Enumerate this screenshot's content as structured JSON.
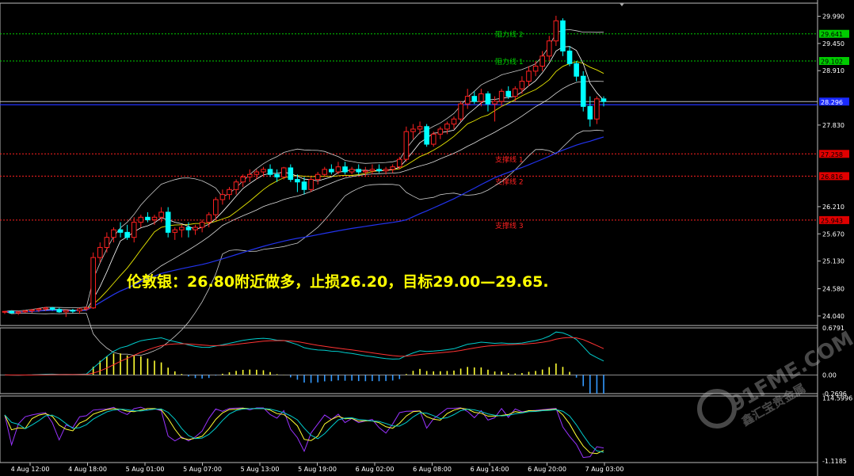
{
  "chart_data": {
    "type": "candlestick",
    "annotation": "伦敦银：26.80附近做多，止损26.20，目标29.00—29.65.",
    "watermark": {
      "main": "91FME.COM",
      "sub": "鑫汇宝贵金属"
    },
    "main_panel": {
      "price_ticks": [
        "29.990",
        "29.450",
        "28.910",
        "27.830",
        "26.210",
        "25.670",
        "25.130",
        "24.580",
        "24.040"
      ],
      "current_price": "28.296",
      "bg": "#000000",
      "bull_color": "#ff2020",
      "bear_color": "#00ffff",
      "levels": [
        {
          "label": "阻力线 2",
          "price": 29.641,
          "tag": "29.641",
          "color": "#00cc00",
          "tag_bg": "#00cc00"
        },
        {
          "label": "阻力线 1",
          "price": 29.102,
          "tag": "29.102",
          "color": "#00cc00",
          "tag_bg": "#00cc00"
        },
        {
          "label": "支撑线 1",
          "price": 27.258,
          "tag": "27.258",
          "color": "#ff2020",
          "tag_bg": "#e00000"
        },
        {
          "label": "支撑线 2",
          "price": 26.816,
          "tag": "26.816",
          "color": "#ff2020",
          "tag_bg": "#e00000"
        },
        {
          "label": "支撑线 3",
          "price": 25.943,
          "tag": "25.943",
          "color": "#ff2020",
          "tag_bg": "#e00000"
        }
      ],
      "x_labels": [
        "4 Aug 12:00",
        "4 Aug 18:00",
        "5 Aug 01:00",
        "5 Aug 07:00",
        "5 Aug 13:00",
        "5 Aug 19:00",
        "6 Aug 02:00",
        "6 Aug 08:00",
        "6 Aug 14:00",
        "6 Aug 20:00",
        "7 Aug 03:00"
      ],
      "candles": [
        [
          24.12,
          24.14,
          24.08,
          24.13
        ],
        [
          24.13,
          24.15,
          24.09,
          24.1
        ],
        [
          24.1,
          24.14,
          24.06,
          24.12
        ],
        [
          24.12,
          24.16,
          24.1,
          24.14
        ],
        [
          24.14,
          24.18,
          24.1,
          24.16
        ],
        [
          24.16,
          24.2,
          24.12,
          24.18
        ],
        [
          24.18,
          24.22,
          24.14,
          24.2
        ],
        [
          24.2,
          24.22,
          24.14,
          24.17
        ],
        [
          24.17,
          24.2,
          24.1,
          24.12
        ],
        [
          24.12,
          24.16,
          24.02,
          24.15
        ],
        [
          24.15,
          24.18,
          24.1,
          24.14
        ],
        [
          24.14,
          24.2,
          24.08,
          24.18
        ],
        [
          24.18,
          24.24,
          24.14,
          24.2
        ],
        [
          24.2,
          25.3,
          24.18,
          25.2
        ],
        [
          25.2,
          25.5,
          25.1,
          25.4
        ],
        [
          25.4,
          25.7,
          25.3,
          25.6
        ],
        [
          25.6,
          25.8,
          25.5,
          25.75
        ],
        [
          25.75,
          25.9,
          25.6,
          25.7
        ],
        [
          25.7,
          25.85,
          25.55,
          25.6
        ],
        [
          25.6,
          26.0,
          25.5,
          25.9
        ],
        [
          25.9,
          26.05,
          25.8,
          26.0
        ],
        [
          26.0,
          26.1,
          25.9,
          25.95
        ],
        [
          25.95,
          26.05,
          25.85,
          26.0
        ],
        [
          26.0,
          26.2,
          25.9,
          26.1
        ],
        [
          26.1,
          26.2,
          25.6,
          25.7
        ],
        [
          25.7,
          25.8,
          25.55,
          25.75
        ],
        [
          25.75,
          25.85,
          25.6,
          25.8
        ],
        [
          25.8,
          25.9,
          25.6,
          25.75
        ],
        [
          25.75,
          25.85,
          25.65,
          25.8
        ],
        [
          25.8,
          25.95,
          25.7,
          25.9
        ],
        [
          25.9,
          26.1,
          25.8,
          26.05
        ],
        [
          26.05,
          26.4,
          25.95,
          26.35
        ],
        [
          26.35,
          26.55,
          26.25,
          26.45
        ],
        [
          26.45,
          26.6,
          26.35,
          26.55
        ],
        [
          26.55,
          26.75,
          26.45,
          26.7
        ],
        [
          26.7,
          26.85,
          26.6,
          26.8
        ],
        [
          26.8,
          26.95,
          26.7,
          26.85
        ],
        [
          26.85,
          26.95,
          26.75,
          26.9
        ],
        [
          26.9,
          27.0,
          26.8,
          26.95
        ],
        [
          26.95,
          27.05,
          26.8,
          26.85
        ],
        [
          26.85,
          26.95,
          26.7,
          26.8
        ],
        [
          26.8,
          27.0,
          26.75,
          26.98
        ],
        [
          26.98,
          27.05,
          26.7,
          26.75
        ],
        [
          26.75,
          26.85,
          26.5,
          26.7
        ],
        [
          26.7,
          26.8,
          26.45,
          26.55
        ],
        [
          26.55,
          26.8,
          26.5,
          26.75
        ],
        [
          26.75,
          26.9,
          26.65,
          26.85
        ],
        [
          26.85,
          27.0,
          26.8,
          26.95
        ],
        [
          26.95,
          27.05,
          26.85,
          26.9
        ],
        [
          26.9,
          27.1,
          26.85,
          27.0
        ],
        [
          27.0,
          27.1,
          26.85,
          26.9
        ],
        [
          26.9,
          27.0,
          26.85,
          26.95
        ],
        [
          26.95,
          27.05,
          26.85,
          26.9
        ],
        [
          26.9,
          27.0,
          26.8,
          26.92
        ],
        [
          26.92,
          27.05,
          26.85,
          26.95
        ],
        [
          26.95,
          27.05,
          26.88,
          26.92
        ],
        [
          26.92,
          27.0,
          26.85,
          26.95
        ],
        [
          26.95,
          27.05,
          26.88,
          27.0
        ],
        [
          27.0,
          27.2,
          26.95,
          27.15
        ],
        [
          27.15,
          27.8,
          27.1,
          27.7
        ],
        [
          27.7,
          27.85,
          27.55,
          27.75
        ],
        [
          27.75,
          27.9,
          27.65,
          27.8
        ],
        [
          27.8,
          27.85,
          27.4,
          27.45
        ],
        [
          27.45,
          27.7,
          27.4,
          27.65
        ],
        [
          27.65,
          27.8,
          27.55,
          27.75
        ],
        [
          27.75,
          27.9,
          27.65,
          27.85
        ],
        [
          27.85,
          28.0,
          27.75,
          27.95
        ],
        [
          27.95,
          28.3,
          27.9,
          28.25
        ],
        [
          28.25,
          28.55,
          28.15,
          28.4
        ],
        [
          28.4,
          28.5,
          28.25,
          28.3
        ],
        [
          28.3,
          28.55,
          28.2,
          28.45
        ],
        [
          28.45,
          28.5,
          28.1,
          28.25
        ],
        [
          28.25,
          28.4,
          27.9,
          28.3
        ],
        [
          28.3,
          28.55,
          28.2,
          28.5
        ],
        [
          28.5,
          28.6,
          28.35,
          28.4
        ],
        [
          28.4,
          28.6,
          28.3,
          28.55
        ],
        [
          28.55,
          28.8,
          28.45,
          28.7
        ],
        [
          28.7,
          29.0,
          28.6,
          28.9
        ],
        [
          28.9,
          29.1,
          28.8,
          29.0
        ],
        [
          29.0,
          29.3,
          28.9,
          29.2
        ],
        [
          29.2,
          29.6,
          29.1,
          29.5
        ],
        [
          29.5,
          30.0,
          29.4,
          29.9
        ],
        [
          29.9,
          29.95,
          29.2,
          29.3
        ],
        [
          29.3,
          29.4,
          29.0,
          29.05
        ],
        [
          29.05,
          29.1,
          28.7,
          28.8
        ],
        [
          28.8,
          28.9,
          28.1,
          28.2
        ],
        [
          28.2,
          28.4,
          27.8,
          27.95
        ],
        [
          27.95,
          28.4,
          27.85,
          28.35
        ],
        [
          28.35,
          28.4,
          28.2,
          28.3
        ]
      ]
    },
    "macd_panel": {
      "ticks": [
        "0.6791",
        "0.00",
        "-0.2696"
      ],
      "hist_color_pos": "#ffff33",
      "hist_color_neg": "#3399ff",
      "line1_color": "#00cccc",
      "line2_color": "#ff3333"
    },
    "osc_panel": {
      "ticks": [
        "114.5996",
        "-1.1185"
      ],
      "line1_color": "#9933ff",
      "line2_color": "#ffff33",
      "line3_color": "#00cccc"
    }
  }
}
